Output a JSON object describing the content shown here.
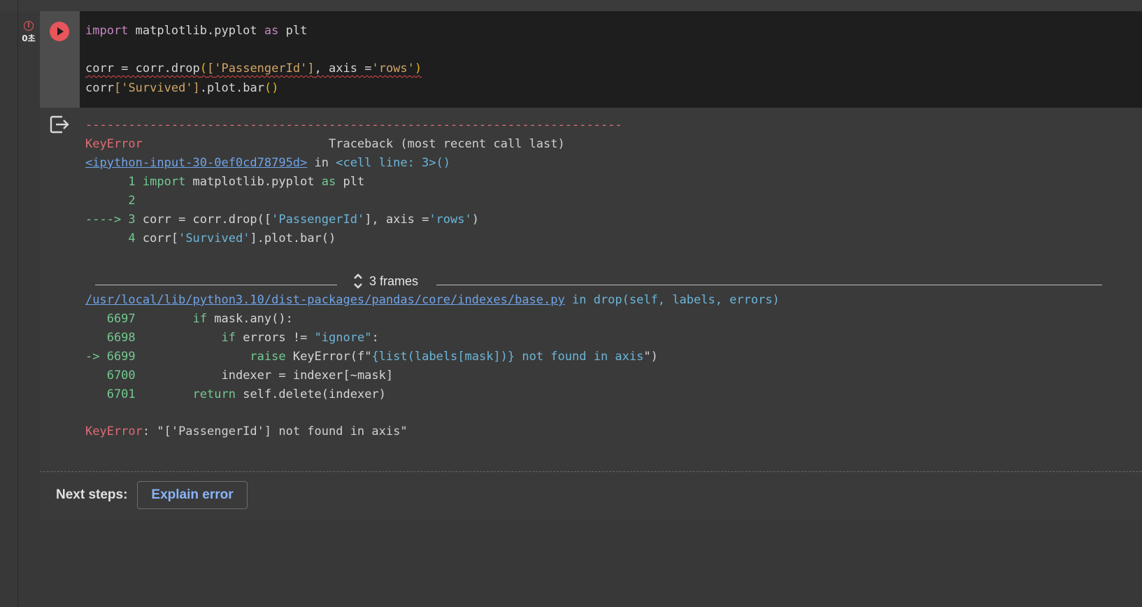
{
  "status": {
    "error_glyph": "!",
    "duration": "0초"
  },
  "editor": {
    "lines": [
      {
        "kw": "import",
        "rest": " matplotlib.pyplot ",
        "kw2": "as",
        "rest2": " plt"
      },
      {
        "blank": ""
      },
      {
        "a": "corr = corr.drop",
        "p1": "(",
        "b1": "[",
        "s1": "'PassengerId'",
        "b2": "]",
        "c": ", axis =",
        "s2": "'rows'",
        "p2": ")"
      },
      {
        "a": "corr",
        "b1": "[",
        "s1": "'Survived'",
        "b2": "]",
        "c": ".plot.bar",
        "p1": "(",
        "p2": ")"
      }
    ]
  },
  "traceback": {
    "dashes": "---------------------------------------------------------------------------",
    "error_name": "KeyError",
    "header_right": "                          Traceback (most recent call last)",
    "link1": "<ipython-input-30-0ef0cd78795d>",
    "link1_rest_in": " in ",
    "link1_func": "<cell line: 3>()",
    "src": [
      {
        "prefix": "      1 ",
        "kw": "import",
        "mid": " matplotlib.pyplot ",
        "kw2": "as",
        "end": " plt"
      },
      {
        "prefix": "      2",
        "text": ""
      },
      {
        "prefix": "----> 3 ",
        "text": "corr = corr.drop([",
        "str1": "'PassengerId'",
        "mid": "], axis =",
        "str2": "'rows'",
        "end": ")"
      },
      {
        "prefix": "      4 ",
        "text": "corr[",
        "str1": "'Survived'",
        "mid": "].plot.bar()"
      }
    ],
    "frames_label": "3 frames",
    "link2": "/usr/local/lib/python3.10/dist-packages/pandas/core/indexes/base.py",
    "link2_rest": " in drop(self, labels, errors)",
    "src2": [
      {
        "prefix": "   6697 ",
        "indent": "       ",
        "kw": "if",
        "text": " mask.any():"
      },
      {
        "prefix": "   6698 ",
        "indent": "           ",
        "kw": "if",
        "text": " errors != ",
        "str": "\"ignore\"",
        "end": ":"
      },
      {
        "prefix": "-> 6699 ",
        "indent": "               ",
        "kw": "raise",
        "text": " KeyError(f\"",
        "str": "{list(labels[mask])} not found in axis",
        "end": "\")"
      },
      {
        "prefix": "   6700 ",
        "indent": "           ",
        "text": "indexer = indexer[~mask]"
      },
      {
        "prefix": "   6701 ",
        "indent": "       ",
        "kw": "return",
        "text": " self.delete(indexer)"
      }
    ],
    "final_name": "KeyError",
    "final_msg": ": \"['PassengerId'] not found in axis\""
  },
  "next_steps": {
    "label": "Next steps:",
    "button": "Explain error"
  }
}
